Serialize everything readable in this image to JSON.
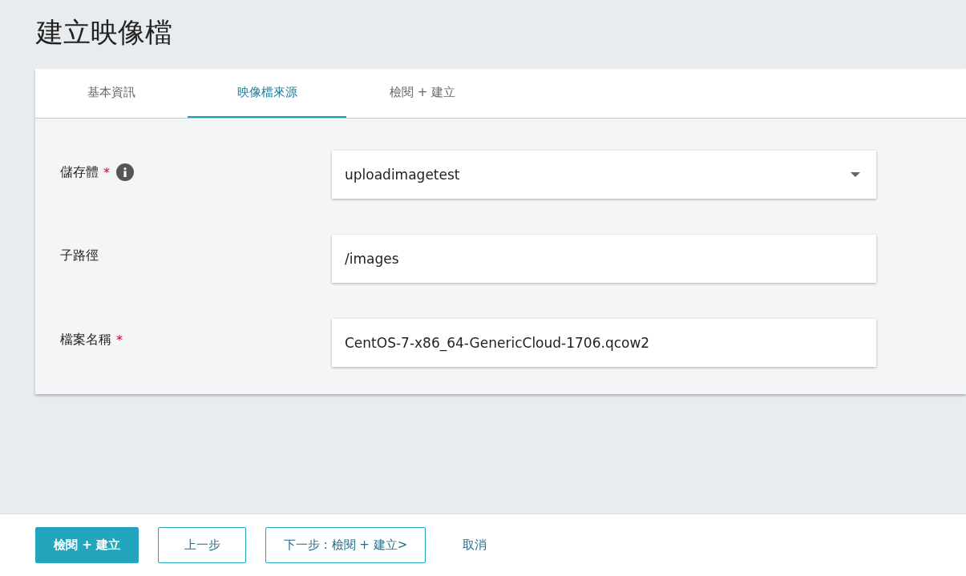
{
  "title": "建立映像檔",
  "tabs": [
    {
      "label": "基本資訊",
      "selected": false
    },
    {
      "label": "映像檔來源",
      "selected": true
    },
    {
      "label": "檢閱 + 建立",
      "selected": false
    }
  ],
  "fields": [
    {
      "label": "儲存體",
      "required_mark": "*",
      "info": true,
      "kind": "select",
      "value": "uploadimagetest"
    },
    {
      "label": "子路徑",
      "info": false,
      "kind": "text",
      "value": "/images"
    },
    {
      "label": "檔案名稱",
      "required_mark": "*",
      "info": false,
      "kind": "text",
      "value": "CentOS-7-x86_64-GenericCloud-1706.qcow2"
    }
  ],
  "buttons": [
    {
      "label": "檢閱 + 建立",
      "kind": "primary"
    },
    {
      "label": "上一步",
      "kind": "secondary"
    },
    {
      "label": "下一步 : 檢閱 + 建立>",
      "kind": "secondary"
    },
    {
      "label": "取消",
      "kind": "link"
    }
  ]
}
